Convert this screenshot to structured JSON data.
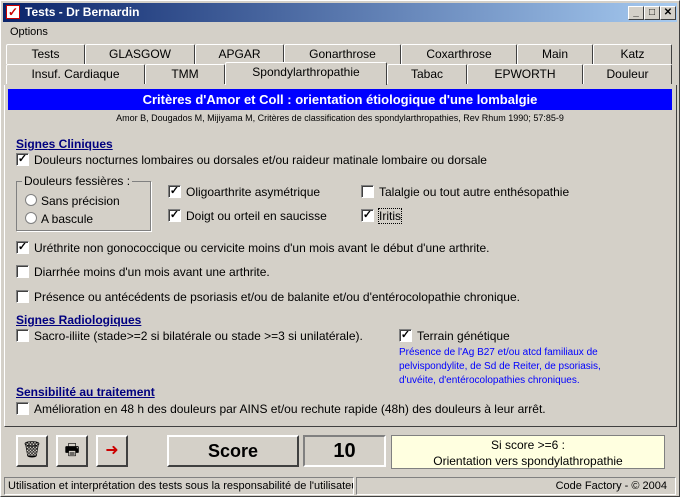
{
  "window": {
    "title": "Tests - Dr Bernardin",
    "app_icon": "checkbox-app-icon",
    "controls": {
      "minimize": "_",
      "maximize": "□",
      "close": "✕"
    }
  },
  "menu": {
    "options": "Options"
  },
  "tabs_row1": [
    "Tests",
    "GLASGOW",
    "APGAR",
    "Gonarthrose",
    "Coxarthrose",
    "Main",
    "Katz"
  ],
  "tabs_row2": [
    "Insuf. Cardiaque",
    "TMM",
    "Spondylarthropathie",
    "Tabac",
    "EPWORTH",
    "Douleur"
  ],
  "active_tab": "Spondylarthropathie",
  "banner": "Critères d'Amor et Coll : orientation étiologique d'une lombalgie",
  "reference": "Amor B, Dougados M, Mijiyama M, Critères de classification des spondylarthropathies, Rev Rhum 1990; 57:85-9",
  "clinical": {
    "title": "Signes Cliniques",
    "douleurs_nocturnes": {
      "label": "Douleurs nocturnes lombaires ou dorsales et/ou raideur matinale lombaire ou dorsale",
      "checked": true
    },
    "fessieres": {
      "legend": "Douleurs fessières :",
      "sans_precision": "Sans précision",
      "a_bascule": "A bascule",
      "selected": ""
    },
    "oligoarthrite": {
      "label": "Oligoarthrite asymétrique",
      "checked": true
    },
    "talalgie": {
      "label": "Talalgie ou tout autre enthésopathie",
      "checked": false
    },
    "doigt": {
      "label": "Doigt ou orteil en saucisse",
      "checked": true
    },
    "iritis": {
      "label": "Iritis",
      "checked": true
    },
    "urethrite": {
      "label": "Uréthrite non gonococcique ou cervicite moins d'un mois avant le début d'une arthrite.",
      "checked": true
    },
    "diarrhee": {
      "label": "Diarrhée moins d'un mois avant une arthrite.",
      "checked": false
    },
    "psoriasis": {
      "label": "Présence ou antécédents de psoriasis et/ou de balanite et/ou d'entérocolopathie chronique.",
      "checked": false
    }
  },
  "radio": {
    "title": "Signes Radiologiques",
    "sacro": {
      "label": "Sacro-iliite (stade>=2 si bilatérale ou stade >=3 si unilatérale).",
      "checked": false
    },
    "terrain": {
      "label": "Terrain génétique",
      "checked": true
    },
    "note_lines": [
      "Présence de l'Ag B27 et/ou atcd familiaux de",
      "pelvispondylite, de Sd de Reiter, de psoriasis,",
      "d'uvéite, d'entérocolopathies chroniques."
    ]
  },
  "treatment": {
    "title": "Sensibilité au traitement",
    "amelioration": {
      "label": "Amélioration en 48 h des douleurs par AINS et/ou rechute rapide (48h) des douleurs à leur arrêt.",
      "checked": false
    }
  },
  "toolbar": {
    "score_label": "Score",
    "score_value": "10",
    "result_line1": "Si score >=6 :",
    "result_line2": "Orientation vers spondylathropathie"
  },
  "status": {
    "left": "Utilisation et interprétation des tests sous la responsabilité de l'utilisateur.",
    "right": "Code Factory - © 2004"
  },
  "colors": {
    "banner": "#0000ff",
    "section": "#00007f",
    "note": "#0000ff",
    "result_bg": "#ffffe0"
  }
}
